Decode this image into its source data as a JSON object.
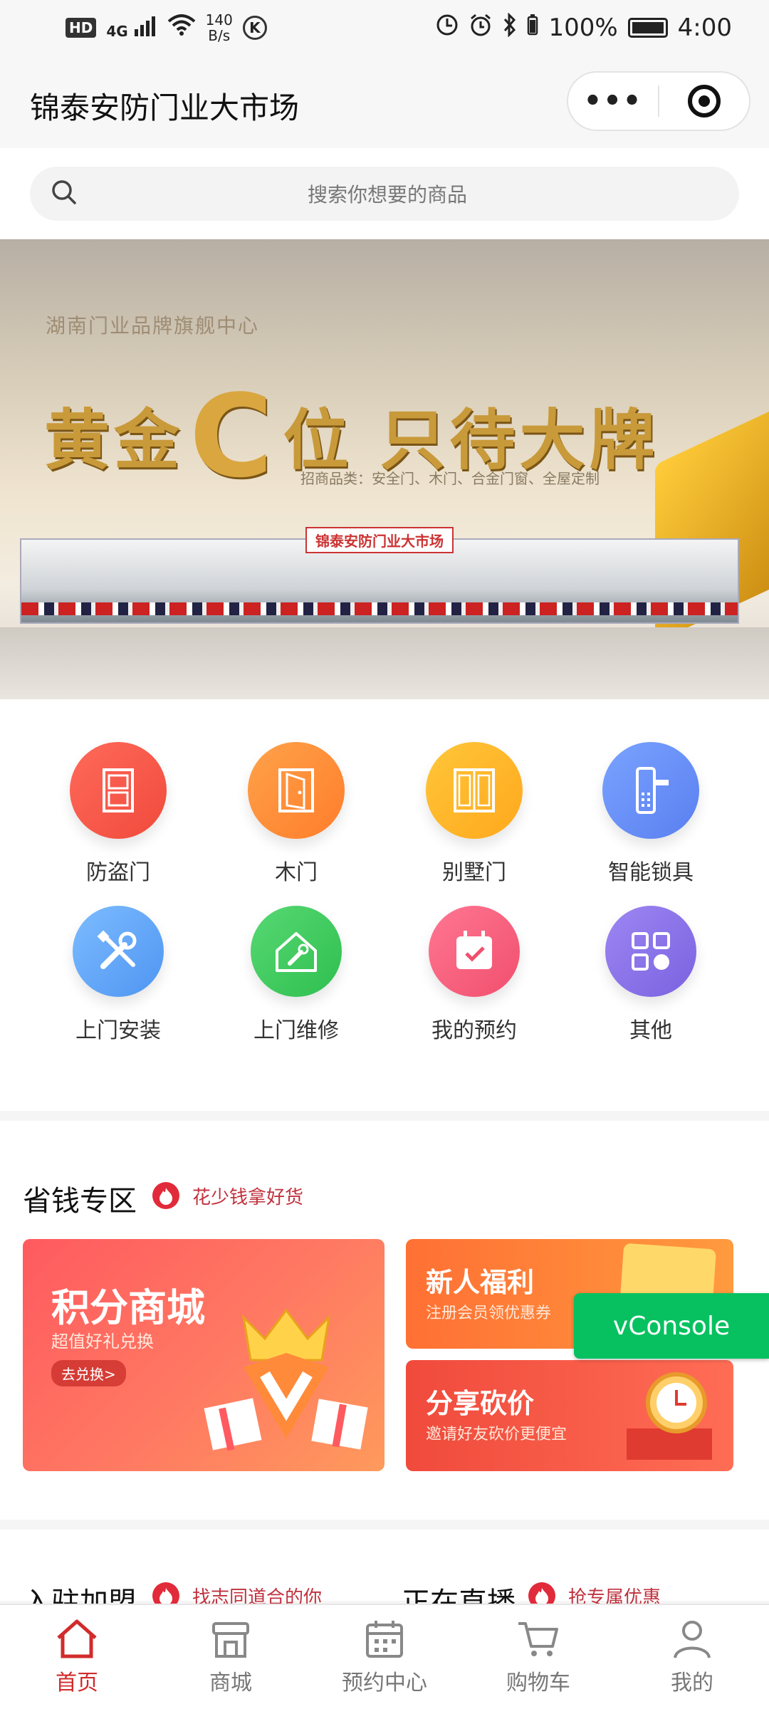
{
  "status_bar": {
    "network": "HD",
    "signal": "4G",
    "speed": "140\nB/s",
    "battery": "100%",
    "time": "4:00"
  },
  "header": {
    "title": "锦泰安防门业大市场",
    "more_glyph": "•••"
  },
  "search": {
    "placeholder": "搜索你想要的商品"
  },
  "banner": {
    "subtitle": "湖南门业品牌旗舰中心",
    "headline_left": "黄金",
    "headline_c": "C",
    "headline_right": "位 只待大牌",
    "categories_line": "招商品类：安全门、木门、合金门窗、全屋定制",
    "building_sign": "锦泰安防门业大市场"
  },
  "categories": [
    {
      "label": "防盗门",
      "color_from": "#ff6a5a",
      "color_to": "#f04a3c"
    },
    {
      "label": "木门",
      "color_from": "#ffa24a",
      "color_to": "#ff7d2b"
    },
    {
      "label": "别墅门",
      "color_from": "#ffc63a",
      "color_to": "#ffa81c"
    },
    {
      "label": "智能锁具",
      "color_from": "#7aa3ff",
      "color_to": "#5a7ff0"
    },
    {
      "label": "上门安装",
      "color_from": "#7dbcff",
      "color_to": "#4f95f2"
    },
    {
      "label": "上门维修",
      "color_from": "#57d873",
      "color_to": "#2fbf4f"
    },
    {
      "label": "我的预约",
      "color_from": "#ff7792",
      "color_to": "#f04f6d"
    },
    {
      "label": "其他",
      "color_from": "#9d86f2",
      "color_to": "#7a62e0"
    }
  ],
  "savings": {
    "title": "省钱专区",
    "tagline": "花少钱拿好货",
    "points_mall": {
      "title": "积分商城",
      "subtitle": "超值好礼兑换",
      "button": "去兑换>"
    },
    "new_user": {
      "title": "新人福利",
      "subtitle": "注册会员领优惠券"
    },
    "share": {
      "title": "分享砍价",
      "subtitle": "邀请好友砍价更便宜"
    }
  },
  "vconsole": "vConsole",
  "join": {
    "title": "入驻加盟",
    "tagline": "找志同道合的你",
    "live_title": "正在直播",
    "live_tagline": "抢专属优惠"
  },
  "tabs": [
    {
      "label": "首页",
      "icon": "home-icon",
      "active": true
    },
    {
      "label": "商城",
      "icon": "store-icon",
      "active": false
    },
    {
      "label": "预约中心",
      "icon": "calendar-icon",
      "active": false
    },
    {
      "label": "购物车",
      "icon": "cart-icon",
      "active": false
    },
    {
      "label": "我的",
      "icon": "user-icon",
      "active": false
    }
  ],
  "colors": {
    "accent": "#d12b2b",
    "vconsole": "#07c160"
  }
}
